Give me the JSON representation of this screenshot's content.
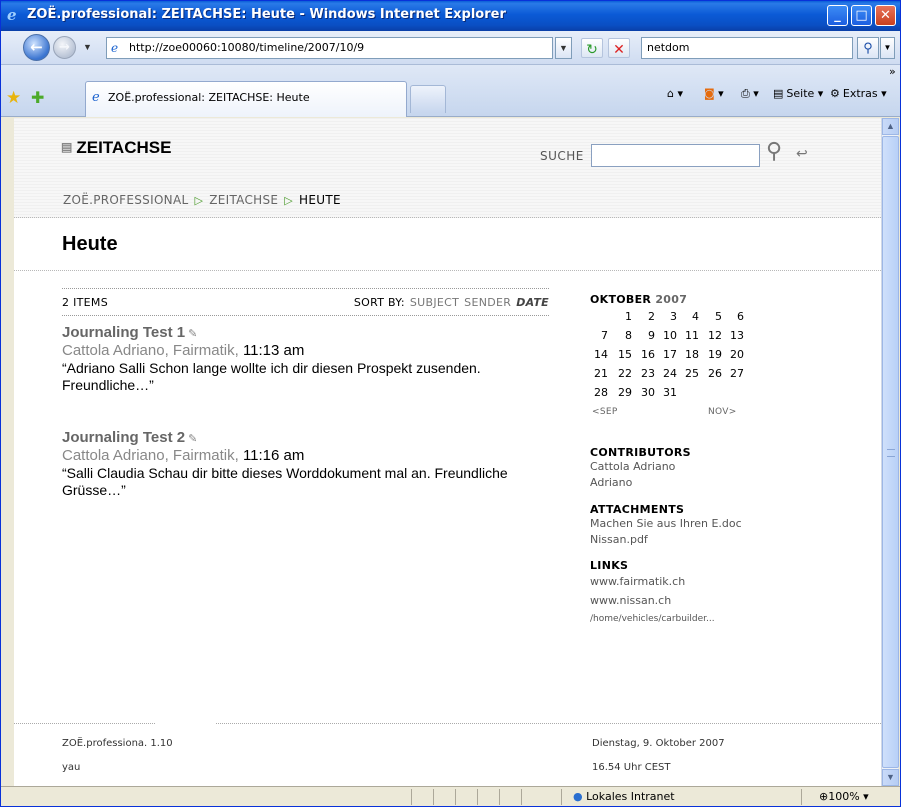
{
  "window": {
    "title": "ZOË.professional: ZEITACHSE: Heute - Windows Internet Explorer",
    "minimize": "_",
    "maximize": "□",
    "close": "✕"
  },
  "addressbar": {
    "url": "http://zoe00060:10080/timeline/2007/10/9",
    "search_value": "netdom"
  },
  "tabs": [
    {
      "label": "ZOË.professional: ZEITACHSE: Heute"
    }
  ],
  "toolbar": {
    "page_label": "Seite",
    "extras_label": "Extras"
  },
  "header": {
    "logo": "ZEITACHSE",
    "search_label": "SUCHE",
    "breadcrumb": [
      "ZOË.PROFESSIONAL",
      "ZEITACHSE",
      "HEUTE"
    ]
  },
  "page": {
    "title": "Heute"
  },
  "list": {
    "count": "2 ITEMS",
    "sort_label": "SORT BY:",
    "sort_options": [
      "SUBJECT",
      "SENDER"
    ],
    "sort_active": "DATE",
    "items": [
      {
        "subject": "Journaling Test 1",
        "sender": "Cattola Adriano",
        "org": "Fairmatik",
        "time": "11:13 am",
        "excerpt": "“Adriano Salli Schon lange wollte ich dir diesen Prospekt zusenden. Freundliche…”"
      },
      {
        "subject": "Journaling Test 2",
        "sender": "Cattola Adriano",
        "org": "Fairmatik",
        "time": "11:16 am",
        "excerpt": "“Salli Claudia Schau dir bitte dieses Worddokument mal an. Freundliche Grüsse…”"
      }
    ]
  },
  "calendar": {
    "month": "OKTOBER",
    "year": "2007",
    "weeks": [
      [
        "",
        "1",
        "2",
        "3",
        "4",
        "5",
        "6"
      ],
      [
        "7",
        "8",
        "9",
        "10",
        "11",
        "12",
        "13"
      ],
      [
        "14",
        "15",
        "16",
        "17",
        "18",
        "19",
        "20"
      ],
      [
        "21",
        "22",
        "23",
        "24",
        "25",
        "26",
        "27"
      ],
      [
        "28",
        "29",
        "30",
        "31",
        "",
        "",
        ""
      ]
    ],
    "prev": "<SEP",
    "next": "NOV>"
  },
  "contributors": {
    "title": "CONTRIBUTORS",
    "items": [
      "Cattola Adriano",
      "Adriano"
    ]
  },
  "attachments": {
    "title": "ATTACHMENTS",
    "items": [
      "Machen Sie aus Ihren E.doc",
      "Nissan.pdf"
    ]
  },
  "links": {
    "title": "LINKS",
    "items": [
      "www.fairmatik.ch",
      "www.nissan.ch",
      "/home/vehicles/carbuilder..."
    ]
  },
  "footer": {
    "left1": "ZOË.professiona. 1.10",
    "left2": "yau",
    "right1": "Dienstag, 9. Oktober 2007",
    "right2": "16.54 Uhr CEST"
  },
  "statusbar": {
    "zone": "Lokales Intranet",
    "zoom": "100%"
  }
}
